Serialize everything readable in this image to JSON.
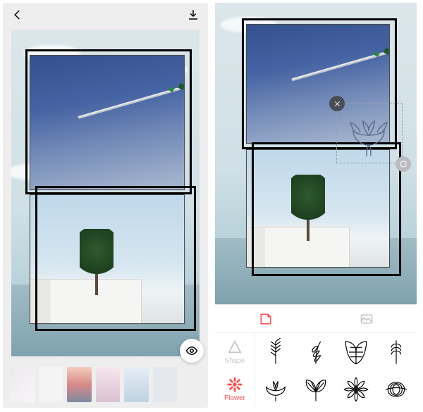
{
  "left": {
    "swatches": [
      "#eceef0",
      "#f2f2f2",
      "#d67c7c",
      "#e2c7d6",
      "#c9d9e6",
      "#d7dce0"
    ]
  },
  "right": {
    "categories": {
      "shape": "Shape",
      "flower": "Flower"
    },
    "stickers": [
      "leaf-branch",
      "eucalyptus",
      "monstera",
      "fern",
      "lotus",
      "ginkgo",
      "dahlia",
      "palm"
    ]
  }
}
